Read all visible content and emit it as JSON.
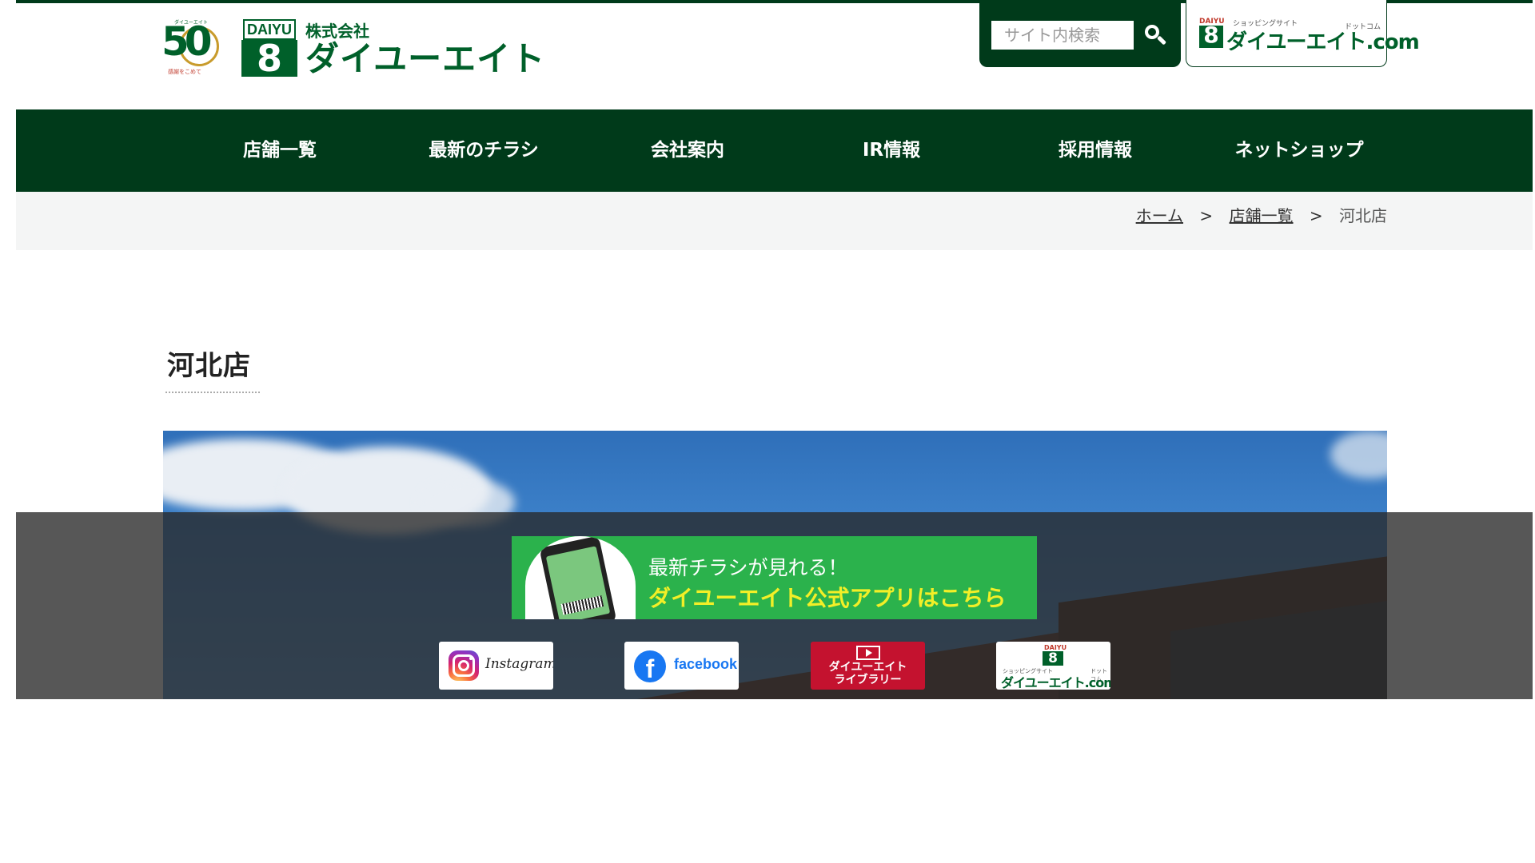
{
  "header": {
    "logo_50": "50",
    "logo_50_top": "ダイユーエイト",
    "logo_50_bottom": "感謝をこめて",
    "logo_daiyu": "DAIYU",
    "logo_eight": "8",
    "logo_corp": "株式会社",
    "logo_name": "ダイユーエイト",
    "search_placeholder": "サイト内検索",
    "dotcom_daiyu": "DAIYU",
    "dotcom_small": "ショッピングサイト",
    "dotcom_dot": "ドットコム",
    "dotcom_eight": "8",
    "dotcom_name": "ダイユーエイト.com"
  },
  "nav": {
    "items": [
      {
        "label": "店舗一覧"
      },
      {
        "label": "最新のチラシ"
      },
      {
        "label": "会社案内"
      },
      {
        "label": "IR情報"
      },
      {
        "label": "採用情報"
      },
      {
        "label": "ネットショップ"
      }
    ]
  },
  "breadcrumb": {
    "home": "ホーム",
    "sep": ">",
    "stores": "店舗一覧",
    "current": "河北店"
  },
  "page": {
    "title": "河北店"
  },
  "banner": {
    "line1": "最新チラシが見れる！",
    "line2": "ダイユーエイト公式アプリはこちら"
  },
  "social": {
    "instagram": "Instagram",
    "facebook_icon": "f",
    "facebook": "facebook",
    "library_line1": "ダイユーエイト",
    "library_line2": "ライブラリー",
    "dotcom_daiyu": "DAIYU",
    "dotcom_eight": "8",
    "dotcom_small": "ショッピングサイト",
    "dotcom_dot": "ドットコム",
    "dotcom_name": "ダイユーエイト.com"
  },
  "colors": {
    "brand_dark_green": "#003a1a",
    "brand_green": "#00602a",
    "app_banner_green": "#2bb24c",
    "app_banner_yellow": "#f2ef27",
    "library_red": "#c4122f"
  }
}
